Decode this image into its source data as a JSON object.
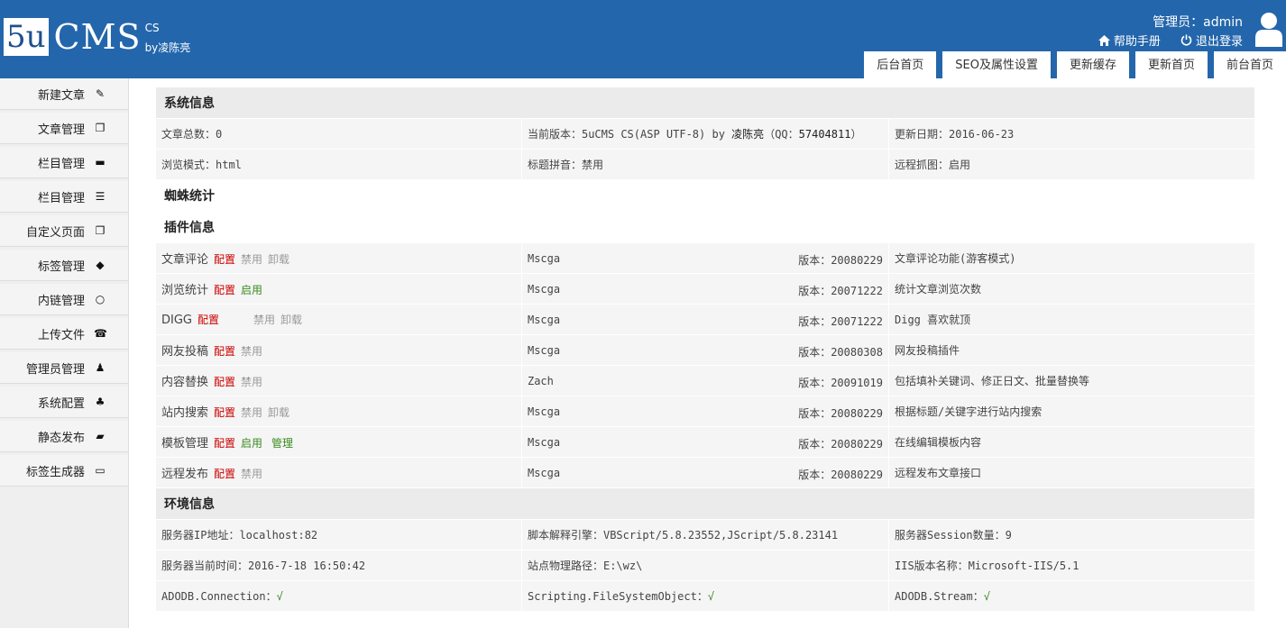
{
  "header": {
    "logo_5u": "5u",
    "logo_cms": "CMS",
    "logo_cs": "CS",
    "logo_by": "by凌陈亮",
    "admin_label": "管理员：admin",
    "help_label": "帮助手册",
    "logout_label": "退出登录",
    "tabs": [
      "后台首页",
      "SEO及属性设置",
      "更新缓存",
      "更新首页",
      "前台首页"
    ]
  },
  "sidebar": {
    "items": [
      {
        "label": "新建文章",
        "icon": "edit-icon",
        "glyph": "✎"
      },
      {
        "label": "文章管理",
        "icon": "copy-icon",
        "glyph": "❐"
      },
      {
        "label": "栏目管理",
        "icon": "folder-icon",
        "glyph": "▬"
      },
      {
        "label": "栏目管理",
        "icon": "briefcase-icon",
        "glyph": "☰"
      },
      {
        "label": "自定义页面",
        "icon": "files-icon",
        "glyph": "❐"
      },
      {
        "label": "标签管理",
        "icon": "tag-icon",
        "glyph": "◆"
      },
      {
        "label": "内链管理",
        "icon": "comment-icon",
        "glyph": "○"
      },
      {
        "label": "上传文件",
        "icon": "phone-icon",
        "glyph": "☎"
      },
      {
        "label": "管理员管理",
        "icon": "user-icon",
        "glyph": "♟"
      },
      {
        "label": "系统配置",
        "icon": "plug-icon",
        "glyph": "♣"
      },
      {
        "label": "静态发布",
        "icon": "folder-open-icon",
        "glyph": "▰"
      },
      {
        "label": "标签生成器",
        "icon": "window-icon",
        "glyph": "▭"
      }
    ]
  },
  "system": {
    "title": "系统信息",
    "article_count": "文章总数：0",
    "version_prefix": "当前版本：5uCMS CS(ASP UTF-8) by",
    "version_author": "凌陈亮",
    "version_qq_prefix": "（QQ：",
    "version_qq": "57404811",
    "version_qq_suffix": "）",
    "update_date": "更新日期：2016-06-23",
    "browse_mode": "浏览模式：html",
    "title_pinyin": "标题拼音：禁用",
    "remote_fetch": "远程抓图：启用"
  },
  "spider": {
    "title": "蜘蛛统计"
  },
  "plugins": {
    "title": "插件信息",
    "rows": [
      {
        "name": "文章评论",
        "configure": "配置",
        "status": "禁用",
        "status_type": "disabled",
        "extra": "卸载",
        "extra_type": "disabled",
        "author": "Mscga",
        "version": "版本：20080229",
        "desc": "文章评论功能(游客模式)"
      },
      {
        "name": "浏览统计",
        "configure": "配置",
        "status": "启用",
        "status_type": "enabled",
        "extra": "",
        "extra_type": "",
        "author": "Mscga",
        "version": "版本：20071222",
        "desc": "统计文章浏览次数"
      },
      {
        "name": "DIGG",
        "configure": "配置",
        "status": "禁用",
        "status_type": "disabled",
        "extra": "卸载",
        "extra_type": "disabled",
        "author": "Mscga",
        "version": "版本：20071222",
        "desc": "Digg 喜欢就顶"
      },
      {
        "name": "网友投稿",
        "configure": "配置",
        "status": "禁用",
        "status_type": "disabled",
        "extra": "",
        "extra_type": "",
        "author": "Mscga",
        "version": "版本：20080308",
        "desc": "网友投稿插件"
      },
      {
        "name": "内容替换",
        "configure": "配置",
        "status": "禁用",
        "status_type": "disabled",
        "extra": "",
        "extra_type": "",
        "author": "Zach",
        "version": "版本：20091019",
        "desc": "包括填补关键词、修正日文、批量替换等"
      },
      {
        "name": "站内搜索",
        "configure": "配置",
        "status": "禁用",
        "status_type": "disabled",
        "extra": "卸载",
        "extra_type": "disabled",
        "author": "Mscga",
        "version": "版本：20080229",
        "desc": "根据标题/关键字进行站内搜索"
      },
      {
        "name": "模板管理",
        "configure": "配置",
        "status": "启用",
        "status_type": "enabled",
        "extra": "管理",
        "extra_type": "enabled",
        "author": "Mscga",
        "version": "版本：20080229",
        "desc": "在线编辑模板内容"
      },
      {
        "name": "远程发布",
        "configure": "配置",
        "status": "禁用",
        "status_type": "disabled",
        "extra": "",
        "extra_type": "",
        "author": "Mscga",
        "version": "版本：20080229",
        "desc": "远程发布文章接口"
      }
    ]
  },
  "env": {
    "title": "环境信息",
    "server_ip": "服务器IP地址：localhost:82",
    "script_engine": "脚本解释引擎：VBScript/5.8.23552,JScript/5.8.23141",
    "session_count": "服务器Session数量：9",
    "server_time": "服务器当前时间：2016-7-18 16:50:42",
    "site_path": "站点物理路径：E:\\wz\\",
    "iis_version": "IIS版本名称：Microsoft-IIS/5.1",
    "adodb_conn": "ADODB.Connection：",
    "fso": "Scripting.FileSystemObject：",
    "adodb_stream": "ADODB.Stream：",
    "check": "√"
  }
}
